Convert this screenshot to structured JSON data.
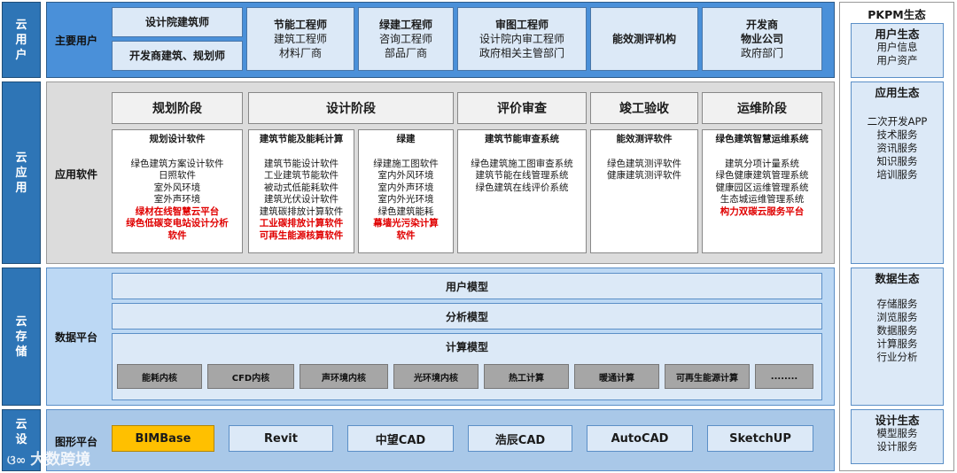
{
  "layers": {
    "cloud_users": "云用户",
    "cloud_apps": "云应用",
    "cloud_storage": "云存储",
    "cloud_design": "云设"
  },
  "users": {
    "label": "主要用户",
    "items": [
      {
        "lines": [
          "设计院建筑师"
        ]
      },
      {
        "lines": [
          "开发商建筑、规划师"
        ]
      },
      {
        "lines": [
          "节能工程师",
          "建筑工程师",
          "材料厂商"
        ]
      },
      {
        "lines": [
          "绿建工程师",
          "咨询工程师",
          "部品厂商"
        ]
      },
      {
        "lines": [
          "审图工程师",
          "设计院内审工程师",
          "政府相关主管部门"
        ]
      },
      {
        "lines": [
          "能效测评机构"
        ]
      },
      {
        "lines": [
          "开发商",
          "物业公司",
          "政府部门"
        ]
      }
    ]
  },
  "apps": {
    "label": "应用软件",
    "stages": [
      "规划阶段",
      "设计阶段",
      "评价审查",
      "竣工验收",
      "运维阶段"
    ],
    "software": [
      {
        "title": "规划设计软件",
        "items": [
          "绿色建筑方案设计软件",
          "日照软件",
          "室外风环境",
          "室外声环境"
        ],
        "red": [
          "绿材在线智慧云平台",
          "绿色低碳变电站设计分析",
          "软件"
        ]
      },
      {
        "title": "建筑节能及能耗计算",
        "items": [
          "建筑节能设计软件",
          "工业建筑节能软件",
          "被动式低能耗软件",
          "建筑光伏设计软件",
          "建筑碳排放计算软件"
        ],
        "red": [
          "工业碳排放计算软件",
          "可再生能源核算软件"
        ]
      },
      {
        "title": "绿建",
        "items": [
          "绿建施工图软件",
          "室内外风环境",
          "室内外声环境",
          "室内外光环境",
          "绿色建筑能耗"
        ],
        "red": [
          "幕墙光污染计算",
          "软件"
        ]
      },
      {
        "title": "建筑节能审查系统",
        "items": [
          "绿色建筑施工图审查系统",
          "建筑节能在线管理系统",
          "绿色建筑在线评价系统"
        ],
        "red": []
      },
      {
        "title": "能效测评软件",
        "items": [
          "绿色建筑测评软件",
          "健康建筑测评软件"
        ],
        "red": []
      },
      {
        "title": "绿色建筑智慧运维系统",
        "items": [
          "建筑分项计量系统",
          "绿色健康建筑管理系统",
          "健康园区运维管理系统",
          "生态城运维管理系统"
        ],
        "red": [
          "构力双碳云服务平台"
        ]
      }
    ]
  },
  "data_platform": {
    "label": "数据平台",
    "models": [
      "用户模型",
      "分析模型",
      "计算模型"
    ],
    "kernels": [
      "能耗内核",
      "CFD内核",
      "声环境内核",
      "光环境内核",
      "热工计算",
      "暖通计算",
      "可再生能源计算",
      "........"
    ]
  },
  "graphics_platform": {
    "label": "图形平台",
    "items": [
      "BIMBase",
      "Revit",
      "中望CAD",
      "浩辰CAD",
      "AutoCAD",
      "SketchUP"
    ]
  },
  "ecosystem": {
    "title": "PKPM生态",
    "groups": [
      {
        "title": "用户生态",
        "items": [
          "用户信息",
          "用户资产"
        ]
      },
      {
        "title": "应用生态",
        "items": [
          "二次开发APP",
          "技术服务",
          "资讯服务",
          "知识服务",
          "培训服务"
        ]
      },
      {
        "title": "数据生态",
        "items": [
          "存储服务",
          "浏览服务",
          "数据服务",
          "计算服务",
          "行业分析"
        ]
      },
      {
        "title": "设计生态",
        "items": [
          "模型服务",
          "设计服务"
        ]
      }
    ]
  },
  "watermark": "大数跨境",
  "colors": {
    "red_text": "#e00000",
    "bimbase_fill": "#ffc000",
    "layer_blue": "#2e75b6"
  }
}
